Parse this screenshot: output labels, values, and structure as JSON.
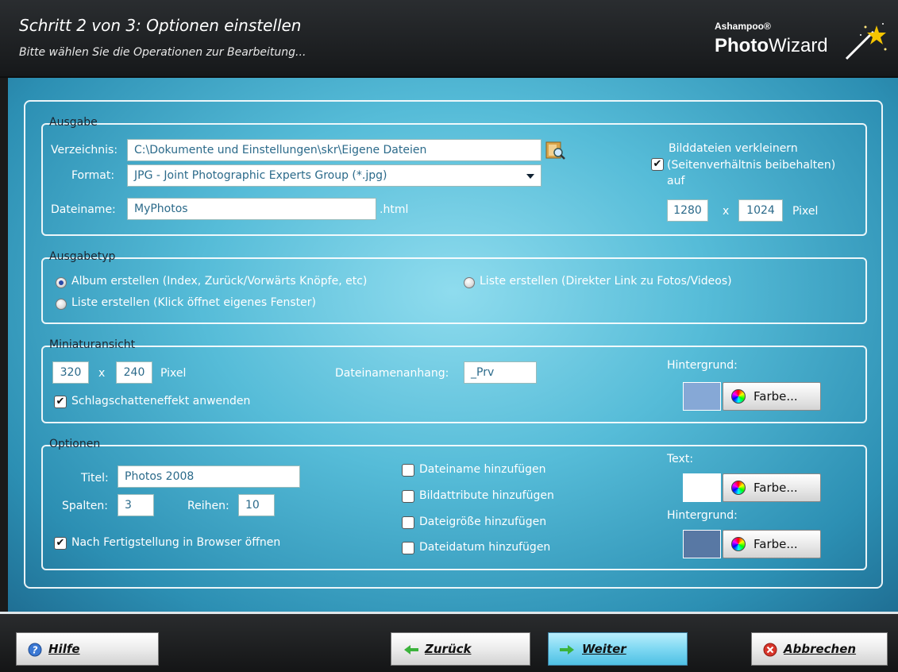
{
  "header": {
    "title": "Schritt 2 von 3: Optionen einstellen",
    "subtitle": "Bitte wählen Sie die Operationen zur Bearbeitung...",
    "logo_small": "Ashampoo®",
    "logo_photo": "Photo",
    "logo_wizard": "Wizard"
  },
  "ausgabe": {
    "legend": "Ausgabe",
    "verzeichnis_label": "Verzeichnis:",
    "verzeichnis_value": "C:\\Dokumente und Einstellungen\\skr\\Eigene Dateien",
    "format_label": "Format:",
    "format_value": "JPG - Joint Photographic Experts Group (*.jpg)",
    "dateiname_label": "Dateiname:",
    "dateiname_value": "MyPhotos",
    "dateiname_ext": ".html",
    "resize_line1": "Bilddateien verkleinern",
    "resize_line2": "(Seitenverhältnis beibehalten)",
    "resize_line3": "auf",
    "resize_checked": true,
    "width": "1280",
    "x": "x",
    "height": "1024",
    "unit": "Pixel"
  },
  "ausgabetyp": {
    "legend": "Ausgabetyp",
    "opt1": "Album erstellen (Index, Zurück/Vorwärts Knöpfe, etc)",
    "opt2": "Liste erstellen (Direkter Link zu Fotos/Videos)",
    "opt3": "Liste erstellen (Klick öffnet eigenes Fenster)",
    "selected": "opt1"
  },
  "miniatur": {
    "legend": "Miniaturansicht",
    "width": "320",
    "x": "x",
    "height": "240",
    "unit": "Pixel",
    "suffix_label": "Dateinamenanhang:",
    "suffix_value": "_Prv",
    "shadow_label": "Schlagschatteneffekt anwenden",
    "shadow_checked": true,
    "bg_label": "Hintergrund:",
    "bg_color": "#86a8d6",
    "color_btn": "Farbe..."
  },
  "optionen": {
    "legend": "Optionen",
    "titel_label": "Titel:",
    "titel_value": "Photos 2008",
    "spalten_label": "Spalten:",
    "spalten_value": "3",
    "reihen_label": "Reihen:",
    "reihen_value": "10",
    "browser_label": "Nach Fertigstellung in Browser öffnen",
    "browser_checked": true,
    "cb1": "Dateiname hinzufügen",
    "cb2": "Bildattribute hinzufügen",
    "cb3": "Dateigröße hinzufügen",
    "cb4": "Dateidatum hinzufügen",
    "text_label": "Text:",
    "text_color": "#ffffff",
    "bg_label": "Hintergrund:",
    "bg_color": "#5878a4",
    "color_btn": "Farbe..."
  },
  "footer": {
    "help": "Hilfe",
    "back": "Zurück",
    "next": "Weiter",
    "cancel": "Abbrechen"
  }
}
